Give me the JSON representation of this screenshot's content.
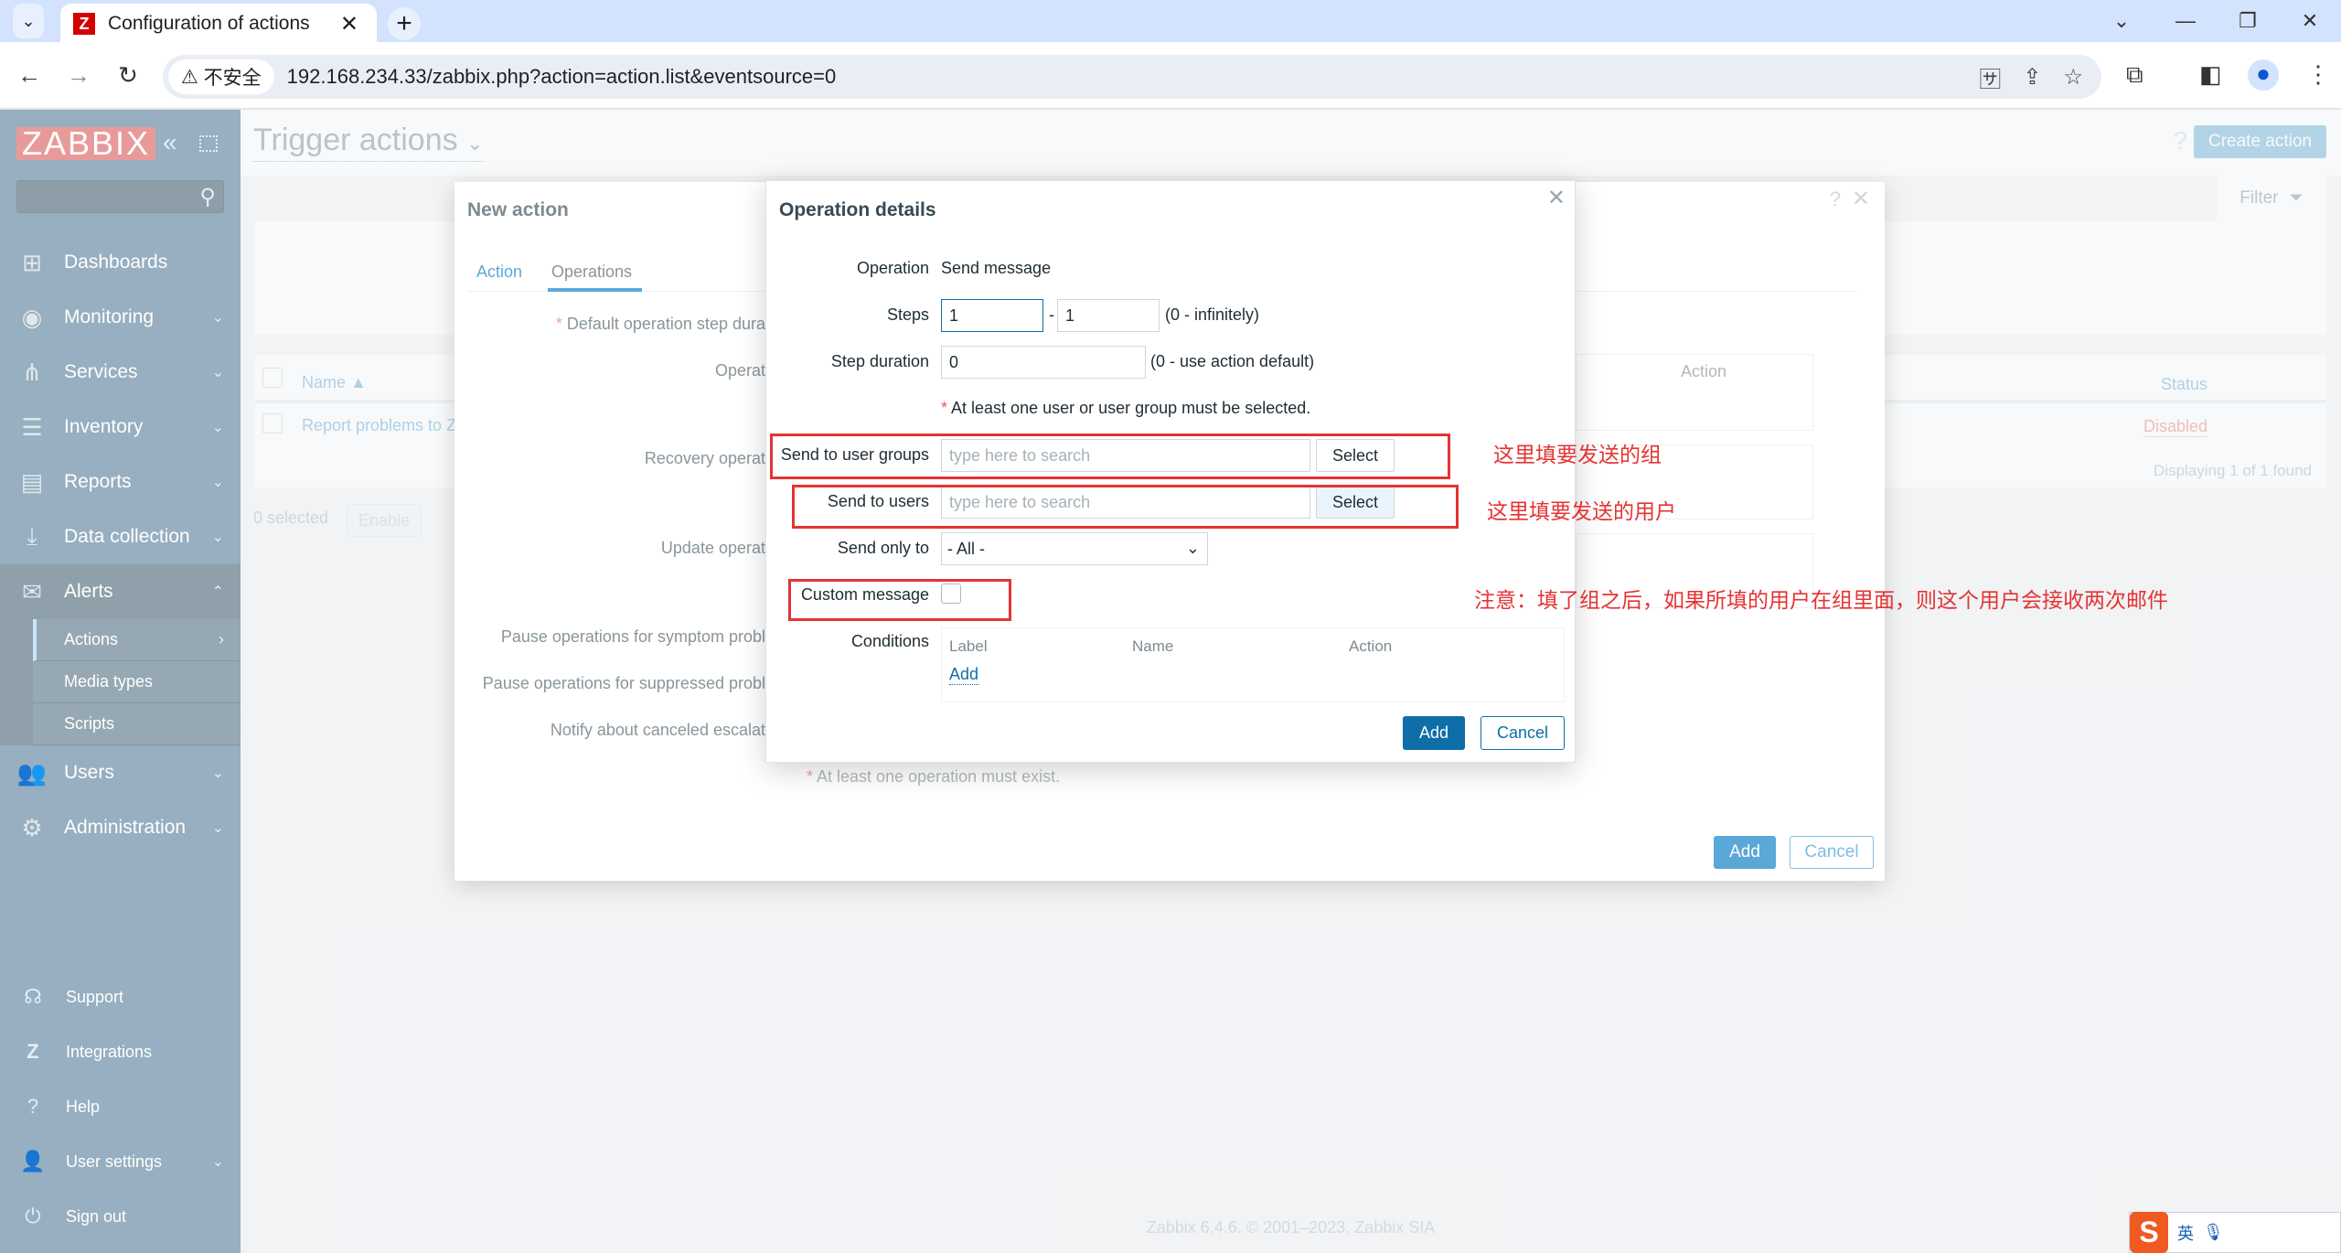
{
  "browser": {
    "tab_title": "Configuration of actions",
    "tab_favicon": "Z",
    "security_label": "不安全",
    "url": "192.168.234.33/zabbix.php?action=action.list&eventsource=0",
    "icons": [
      "tab-search-icon",
      "minimize-icon",
      "restore-icon",
      "close-icon",
      "back-icon",
      "forward-icon",
      "reload-icon",
      "translate-icon",
      "share-icon",
      "bookmark-star-icon",
      "extensions-icon",
      "side-panel-icon",
      "profile-icon",
      "more-icon"
    ]
  },
  "sidebar": {
    "logo": "ZABBIX",
    "search_placeholder": "",
    "items": [
      {
        "label": "Dashboards",
        "icon": "dashboards-icon",
        "expandable": false
      },
      {
        "label": "Monitoring",
        "icon": "eye-icon",
        "expandable": true
      },
      {
        "label": "Services",
        "icon": "services-icon",
        "expandable": true
      },
      {
        "label": "Inventory",
        "icon": "list-icon",
        "expandable": true
      },
      {
        "label": "Reports",
        "icon": "reports-icon",
        "expandable": true
      },
      {
        "label": "Data collection",
        "icon": "download-icon",
        "expandable": true
      },
      {
        "label": "Alerts",
        "icon": "envelope-icon",
        "expandable": true,
        "open": true
      },
      {
        "label": "Users",
        "icon": "users-icon",
        "expandable": true
      },
      {
        "label": "Administration",
        "icon": "gear-icon",
        "expandable": true
      }
    ],
    "alerts_submenu": [
      {
        "label": "Actions",
        "active": true
      },
      {
        "label": "Media types"
      },
      {
        "label": "Scripts"
      }
    ],
    "bottom_items": [
      {
        "label": "Support",
        "icon": "headset-icon"
      },
      {
        "label": "Integrations",
        "icon": "zabbix-z-icon"
      },
      {
        "label": "Help",
        "icon": "question-icon"
      },
      {
        "label": "User settings",
        "icon": "user-icon",
        "expandable": true
      },
      {
        "label": "Sign out",
        "icon": "power-icon"
      }
    ]
  },
  "page": {
    "title": "Trigger actions",
    "help": "?",
    "create_button": "Create action",
    "filter_label": "Filter",
    "table": {
      "col_name": "Name ▲",
      "col_status": "Status",
      "rows": [
        {
          "name": "Report problems to Z",
          "status": "Disabled"
        }
      ],
      "displaying": "Displaying 1 of 1 found"
    },
    "selected_count": "0 selected",
    "enable_button": "Enable",
    "footer": "Zabbix 6.4.6. © 2001–2023, Zabbix SIA"
  },
  "new_action_dialog": {
    "title": "New action",
    "help": "?",
    "close": "✕",
    "tabs": [
      {
        "label": "Action"
      },
      {
        "label": "Operations",
        "active": true
      }
    ],
    "labels": {
      "default_step": "Default operation step dura",
      "operations": "Operat",
      "recovery": "Recovery operat",
      "update": "Update operat",
      "pause_symptom": "Pause operations for symptom probl",
      "pause_suppressed": "Pause operations for suppressed probl",
      "notify_canceled": "Notify about canceled escalat"
    },
    "ghost_action_header": "Action",
    "min_operation_note": "At least one operation must exist.",
    "add_button": "Add",
    "cancel_button": "Cancel"
  },
  "operation_dialog": {
    "title": "Operation details",
    "close": "✕",
    "operation_label": "Operation",
    "operation_value": "Send message",
    "steps_label": "Steps",
    "steps_from": "1",
    "steps_sep": "-",
    "steps_to": "1",
    "steps_hint": "(0 - infinitely)",
    "step_duration_label": "Step duration",
    "step_duration_value": "0",
    "step_duration_hint": "(0 - use action default)",
    "required_note": "At least one user or user group must be selected.",
    "user_groups_label": "Send to user groups",
    "user_groups_placeholder": "type here to search",
    "users_label": "Send to users",
    "users_placeholder": "type here to search",
    "select_button": "Select",
    "send_only_to_label": "Send only to",
    "send_only_to_value": "- All -",
    "custom_message_label": "Custom message",
    "custom_message_checked": false,
    "conditions_label": "Conditions",
    "conditions_headers": [
      "Label",
      "Name",
      "Action"
    ],
    "conditions_add": "Add",
    "add_button": "Add",
    "cancel_button": "Cancel"
  },
  "annotations": {
    "groups_note": "这里填要发送的组",
    "users_note": "这里填要发送的用户",
    "warning_note": "注意：填了组之后，如果所填的用户在组里面，则这个用户会接收两次邮件",
    "color": "#e53333"
  },
  "taskbar": {
    "ime_text": "英"
  }
}
